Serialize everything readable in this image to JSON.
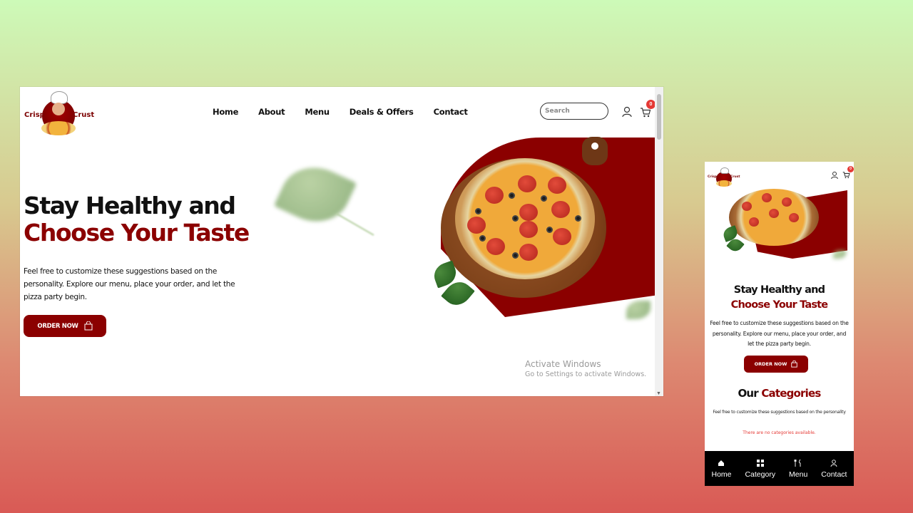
{
  "brand": {
    "left": "Crisp",
    "right": "Crust"
  },
  "nav": [
    "Home",
    "About",
    "Menu",
    "Deals & Offers",
    "Contact"
  ],
  "search": {
    "placeholder": "Search"
  },
  "cart": {
    "count": "0"
  },
  "hero": {
    "line1": "Stay Healthy and",
    "line2": "Choose Your Taste",
    "paragraph": "Feel free to customize these suggestions based on the personality. Explore our menu, place your order, and let the pizza party begin.",
    "cta": "ORDER NOW"
  },
  "watermark": {
    "title": "Activate Windows",
    "subtitle": "Go to Settings to activate Windows."
  },
  "mobile": {
    "brand": {
      "left": "Crisp",
      "right": "Crust"
    },
    "cart_count": "0",
    "line1": "Stay Healthy and",
    "line2": "Choose Your Taste",
    "paragraph": "Feel free to customize these suggestions based on the personality. Explore our menu, place your order, and let the pizza party begin.",
    "cta": "ORDER NOW",
    "categories": {
      "title_a": "Our",
      "title_b": "Categories",
      "subtitle": "Feel free to customize these suggestions based on the personality",
      "empty": "There are no categories available."
    },
    "bottom_nav": [
      {
        "label": "Home",
        "icon": "home-icon"
      },
      {
        "label": "Category",
        "icon": "grid-icon"
      },
      {
        "label": "Menu",
        "icon": "utensils-icon"
      },
      {
        "label": "Contact",
        "icon": "contact-icon"
      }
    ]
  },
  "colors": {
    "brand_red": "#8b0000",
    "badge_red": "#e53935",
    "nav_bar": "#000000"
  }
}
